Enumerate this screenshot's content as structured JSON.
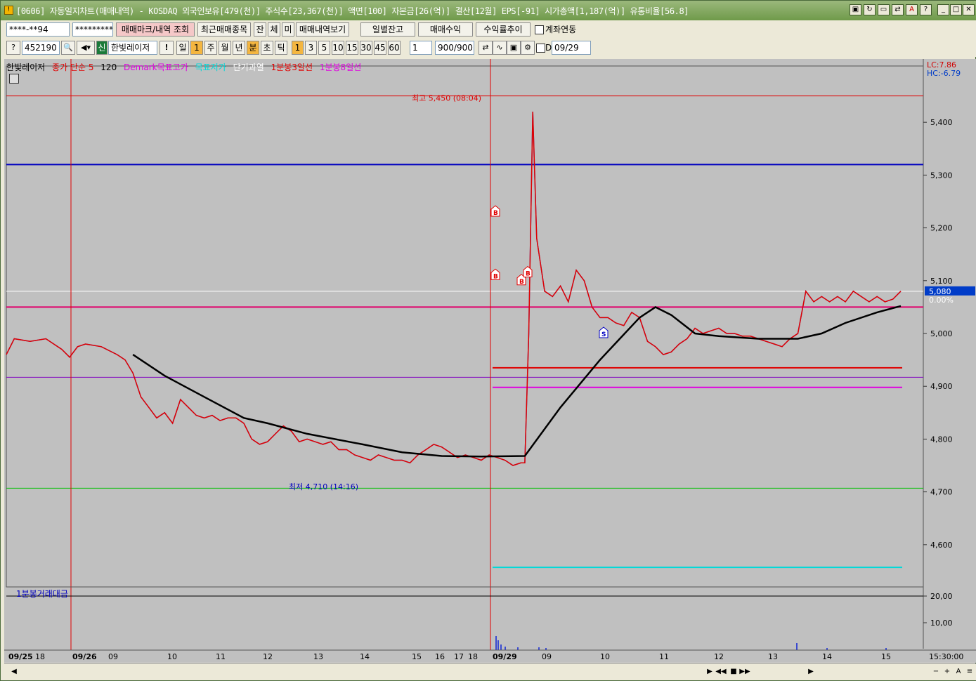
{
  "window": {
    "title": "[0606] 자동일지차트(매매내역) - KOSDAQ 외국인보유[479(천)] 주식수[23,367(천)] 액면[100] 자본금[26(억)] 결산[12월] EPS[-91] 시가총액[1,187(억)] 유통비율[56.8]"
  },
  "toolbar1": {
    "account": "****-**94",
    "password": "*********",
    "trade_mark_button": "매매마크/내역 조회",
    "recent_trades": "최근매매종목",
    "jan": "잔",
    "che": "체",
    "mi": "미",
    "trade_history": "매매내역보기",
    "daily_balance": "일별잔고",
    "trade_profit": "매매수익",
    "return_trend": "수익률추이",
    "account_link": "계좌연동"
  },
  "toolbar2": {
    "code": "452190",
    "signal_badge": "신",
    "stock_name": "한빛레이저",
    "periods": [
      "일",
      "1",
      "주",
      "월",
      "년",
      "분",
      "초",
      "틱"
    ],
    "minutes": [
      "1",
      "3",
      "5",
      "10",
      "15",
      "30",
      "45",
      "60"
    ],
    "count_select": "1",
    "count": "900/900",
    "d_label": "D",
    "date": "09/29"
  },
  "legend": {
    "name": "한빛레이저",
    "close_ma": "종가 단순 5",
    "ma_period": "120",
    "demark": "Demark목표고가",
    "target": "목표저가",
    "short_term": "단기과열",
    "line3": "1분봉3일선",
    "line8": "1분봉8일선"
  },
  "right_info": {
    "lc": "LC:7.86",
    "hc": "HC:-6.79",
    "current_price": "5,080",
    "current_pct": "0.00%"
  },
  "annotations": {
    "high": "최고 5,450 (08:04)",
    "low": "최저 4,710 (14:16)"
  },
  "markers": [
    "B",
    "B",
    "B",
    "B",
    "S"
  ],
  "volume_label": "1분봉거래대금",
  "x_labels": [
    "09/25",
    "18",
    "09/26",
    "09",
    "10",
    "11",
    "12",
    "13",
    "14",
    "15",
    "16",
    "17",
    "18",
    "09/29",
    "09",
    "10",
    "11",
    "12",
    "13",
    "14",
    "15"
  ],
  "time_label": "15:30:00",
  "chart_data": {
    "type": "line",
    "y_ticks": [
      "5,400",
      "5,300",
      "5,200",
      "5,100",
      "5,000",
      "4,900",
      "4,800",
      "4,700",
      "4,600"
    ],
    "y_min": 4520,
    "y_max": 5480,
    "vol_ticks": [
      "20,00",
      "10,00"
    ],
    "hlines": [
      {
        "value": 5450,
        "color": "#e00000"
      },
      {
        "value": 5320,
        "color": "#0000c0"
      },
      {
        "value": 5080,
        "color": "#ffffff"
      },
      {
        "value": 5050,
        "color": "#e0006a"
      },
      {
        "value": 4917,
        "color": "#8000c0"
      },
      {
        "value": 4707,
        "color": "#00c000"
      }
    ],
    "target_lines": [
      {
        "value": 4935,
        "color": "#e00000"
      },
      {
        "value": 4898,
        "color": "#e000e0"
      },
      {
        "value": 4557,
        "color": "#00d8d8"
      }
    ],
    "price_series": [
      [
        0,
        4960
      ],
      [
        0.01,
        4990
      ],
      [
        0.03,
        4985
      ],
      [
        0.05,
        4990
      ],
      [
        0.07,
        4970
      ],
      [
        0.08,
        4955
      ],
      [
        0.09,
        4975
      ],
      [
        0.1,
        4980
      ],
      [
        0.12,
        4975
      ],
      [
        0.14,
        4960
      ],
      [
        0.15,
        4950
      ],
      [
        0.16,
        4925
      ],
      [
        0.17,
        4880
      ],
      [
        0.18,
        4860
      ],
      [
        0.19,
        4840
      ],
      [
        0.2,
        4850
      ],
      [
        0.21,
        4830
      ],
      [
        0.22,
        4875
      ],
      [
        0.23,
        4860
      ],
      [
        0.24,
        4845
      ],
      [
        0.25,
        4840
      ],
      [
        0.26,
        4845
      ],
      [
        0.27,
        4835
      ],
      [
        0.28,
        4840
      ],
      [
        0.29,
        4840
      ],
      [
        0.3,
        4830
      ],
      [
        0.31,
        4800
      ],
      [
        0.32,
        4790
      ],
      [
        0.33,
        4795
      ],
      [
        0.34,
        4810
      ],
      [
        0.35,
        4825
      ],
      [
        0.36,
        4815
      ],
      [
        0.37,
        4795
      ],
      [
        0.38,
        4800
      ],
      [
        0.39,
        4795
      ],
      [
        0.4,
        4790
      ],
      [
        0.41,
        4795
      ],
      [
        0.42,
        4780
      ],
      [
        0.43,
        4780
      ],
      [
        0.44,
        4770
      ],
      [
        0.45,
        4765
      ],
      [
        0.46,
        4760
      ],
      [
        0.47,
        4770
      ],
      [
        0.48,
        4765
      ],
      [
        0.49,
        4760
      ],
      [
        0.5,
        4760
      ],
      [
        0.51,
        4755
      ],
      [
        0.52,
        4770
      ],
      [
        0.53,
        4780
      ],
      [
        0.54,
        4790
      ],
      [
        0.55,
        4785
      ],
      [
        0.56,
        4775
      ],
      [
        0.57,
        4765
      ],
      [
        0.58,
        4770
      ],
      [
        0.59,
        4765
      ],
      [
        0.6,
        4760
      ],
      [
        0.61,
        4770
      ],
      [
        0.62,
        4765
      ],
      [
        0.63,
        4760
      ],
      [
        0.64,
        4750
      ],
      [
        0.65,
        4755
      ],
      [
        0.655,
        4755
      ],
      [
        0.66,
        5000
      ],
      [
        0.665,
        5420
      ],
      [
        0.67,
        5180
      ],
      [
        0.68,
        5080
      ],
      [
        0.69,
        5070
      ],
      [
        0.7,
        5090
      ],
      [
        0.71,
        5060
      ],
      [
        0.72,
        5120
      ],
      [
        0.73,
        5100
      ],
      [
        0.74,
        5050
      ],
      [
        0.75,
        5030
      ],
      [
        0.76,
        5030
      ],
      [
        0.77,
        5020
      ],
      [
        0.78,
        5015
      ],
      [
        0.79,
        5040
      ],
      [
        0.8,
        5030
      ],
      [
        0.81,
        4985
      ],
      [
        0.82,
        4975
      ],
      [
        0.83,
        4960
      ],
      [
        0.84,
        4965
      ],
      [
        0.85,
        4980
      ],
      [
        0.86,
        4990
      ],
      [
        0.87,
        5010
      ],
      [
        0.88,
        5000
      ],
      [
        0.89,
        5005
      ],
      [
        0.9,
        5010
      ],
      [
        0.91,
        5000
      ],
      [
        0.92,
        5000
      ],
      [
        0.93,
        4995
      ],
      [
        0.94,
        4995
      ],
      [
        0.95,
        4990
      ],
      [
        0.96,
        4985
      ],
      [
        0.97,
        4980
      ],
      [
        0.98,
        4975
      ],
      [
        0.99,
        4990
      ],
      [
        1.0,
        5000
      ],
      [
        1.01,
        5080
      ],
      [
        1.02,
        5060
      ],
      [
        1.03,
        5070
      ],
      [
        1.04,
        5060
      ],
      [
        1.05,
        5070
      ],
      [
        1.06,
        5060
      ],
      [
        1.07,
        5080
      ],
      [
        1.08,
        5070
      ],
      [
        1.09,
        5060
      ],
      [
        1.1,
        5070
      ],
      [
        1.11,
        5060
      ],
      [
        1.12,
        5065
      ],
      [
        1.13,
        5080
      ]
    ],
    "ma_series": [
      [
        0.16,
        4960
      ],
      [
        0.2,
        4920
      ],
      [
        0.25,
        4880
      ],
      [
        0.3,
        4840
      ],
      [
        0.33,
        4830
      ],
      [
        0.38,
        4810
      ],
      [
        0.45,
        4790
      ],
      [
        0.5,
        4775
      ],
      [
        0.55,
        4768
      ],
      [
        0.6,
        4767
      ],
      [
        0.655,
        4768
      ],
      [
        0.7,
        4860
      ],
      [
        0.75,
        4950
      ],
      [
        0.8,
        5030
      ],
      [
        0.82,
        5050
      ],
      [
        0.84,
        5035
      ],
      [
        0.87,
        5000
      ],
      [
        0.9,
        4995
      ],
      [
        0.95,
        4990
      ],
      [
        1.0,
        4990
      ],
      [
        1.03,
        5000
      ],
      [
        1.06,
        5020
      ],
      [
        1.1,
        5040
      ],
      [
        1.13,
        5052
      ]
    ]
  }
}
